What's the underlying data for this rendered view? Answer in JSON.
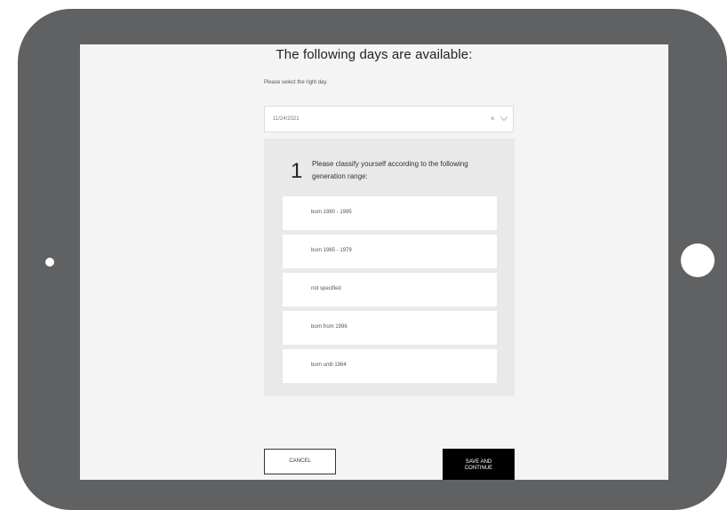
{
  "title": "The following days are available:",
  "subtitle": "Please select the right day.",
  "date_select": {
    "value": "11/24/2021",
    "clear_symbol": "×",
    "chevron_icon": "chevron-down-icon"
  },
  "question": {
    "number": "1",
    "text": "Please classify yourself according to the following generation range:",
    "options": [
      "born 1980 - 1995",
      "born 1965 - 1979",
      "not specified",
      "born from 1996",
      "born until 1964"
    ]
  },
  "buttons": {
    "cancel": "CANCEL",
    "save_line1": "SAVE AND",
    "save_line2": "CONTINUE"
  },
  "colors": {
    "device_frame": "#5f6163",
    "screen_background": "#f4f4f4",
    "panel_background": "#e9e9e9",
    "primary_button": "#000000"
  }
}
